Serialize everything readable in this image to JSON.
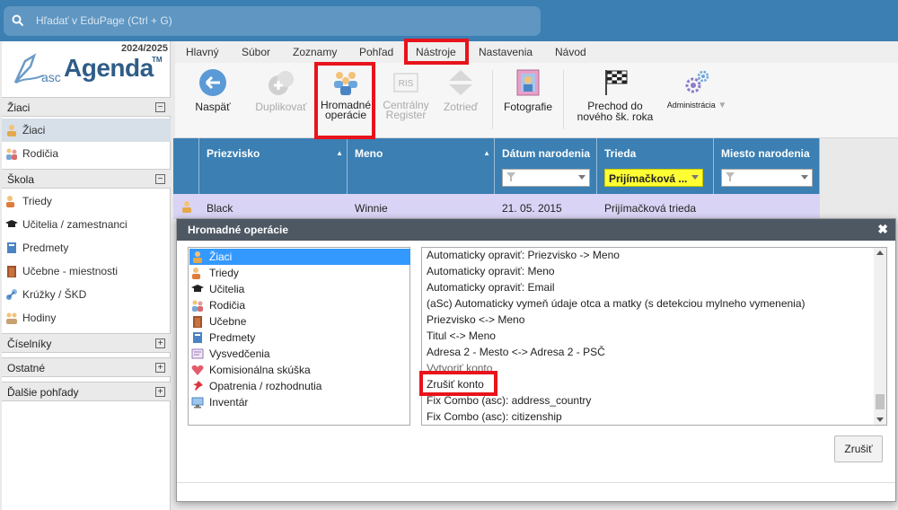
{
  "search": {
    "placeholder": "Hľadať v EduPage (Ctrl + G)"
  },
  "brand": {
    "year": "2024/2025",
    "prefix": "asc",
    "name": "Agenda",
    "tm": "TM"
  },
  "sidebar": {
    "sections": [
      {
        "label": "Žiaci",
        "toggle": "−",
        "items": [
          {
            "label": "Žiaci",
            "icon": "student-icon",
            "selected": true
          },
          {
            "label": "Rodičia",
            "icon": "parents-icon"
          }
        ]
      },
      {
        "label": "Škola",
        "toggle": "−",
        "items": [
          {
            "label": "Triedy",
            "icon": "class-icon"
          },
          {
            "label": "Učitelia / zamestnanci",
            "icon": "teacher-cap-icon"
          },
          {
            "label": "Predmety",
            "icon": "book-icon"
          },
          {
            "label": "Učebne - miestnosti",
            "icon": "door-icon"
          },
          {
            "label": "Krúžky / ŠKD",
            "icon": "club-icon"
          },
          {
            "label": "Hodiny",
            "icon": "lessons-icon"
          }
        ]
      },
      {
        "label": "Číselníky",
        "toggle": "+"
      },
      {
        "label": "Ostatné",
        "toggle": "+"
      },
      {
        "label": "Ďalšie pohľady",
        "toggle": "+"
      }
    ]
  },
  "menu": [
    "Hlavný",
    "Súbor",
    "Zoznamy",
    "Pohľad",
    "Nástroje",
    "Nastavenia",
    "Návod"
  ],
  "menu_active": "Nástroje",
  "toolbar": {
    "back": "Naspäť",
    "duplicate": "Duplikovať",
    "bulk_1": "Hromadné",
    "bulk_2": "operácie",
    "registry_1": "Centrálny",
    "registry_2": "Register",
    "sort": "Zotrieď",
    "photos": "Fotografie",
    "transition_1": "Prechod do",
    "transition_2": "nového šk. roka",
    "admin": "Administrácia",
    "ris_text": "RIS"
  },
  "grid": {
    "columns": [
      "Priezvisko",
      "Meno",
      "Dátum narodenia",
      "Trieda",
      "Miesto narodenia"
    ],
    "sort_arrow": "▲",
    "class_filter": "Prijímačková ...",
    "row": {
      "surname": "Black",
      "name": "Winnie",
      "birth": "21. 05. 2015",
      "class": "Prijímačková trieda",
      "place": ""
    }
  },
  "dialog": {
    "title": "Hromadné operácie",
    "close": "✖",
    "categories": [
      {
        "label": "Žiaci",
        "icon": "student-icon",
        "selected": true
      },
      {
        "label": "Triedy",
        "icon": "class-icon"
      },
      {
        "label": "Učitelia",
        "icon": "teacher-cap-icon"
      },
      {
        "label": "Rodičia",
        "icon": "parents-icon"
      },
      {
        "label": "Učebne",
        "icon": "door-icon"
      },
      {
        "label": "Predmety",
        "icon": "book-icon"
      },
      {
        "label": "Vysvedčenia",
        "icon": "certificate-icon"
      },
      {
        "label": "Komisionálna skúška",
        "icon": "heart-icon"
      },
      {
        "label": "Opatrenia / rozhodnutia",
        "icon": "pin-icon"
      },
      {
        "label": "Inventár",
        "icon": "monitor-icon"
      }
    ],
    "operations": [
      "Automaticky opraviť: Priezvisko -> Meno",
      "Automaticky opraviť: Meno",
      "Automaticky opraviť: Email",
      "(aSc) Automaticky vymeň údaje otca a matky (s detekciou mylneho vymenenia)",
      "Priezvisko <-> Meno",
      "Titul <-> Meno",
      "Adresa 2 - Mesto <-> Adresa 2 - PSČ",
      "Vytvoriť konto",
      "Zrušiť konto",
      "Fix Combo (asc): address_country",
      "Fix Combo (asc): citizenship"
    ],
    "cancel": "Zrušiť"
  },
  "colors": {
    "header_blue": "#3b7fb3",
    "highlight_red": "#e8131b",
    "selected_blue": "#3399ff",
    "row_lavender": "#d9d4f5"
  }
}
